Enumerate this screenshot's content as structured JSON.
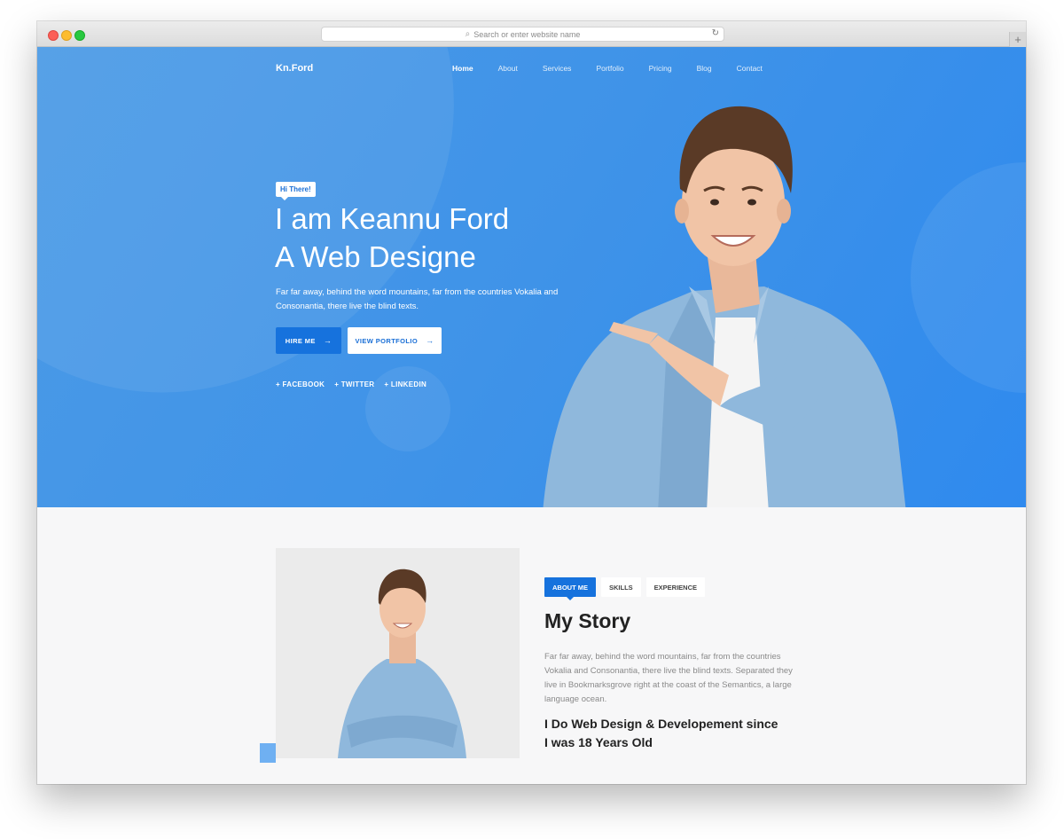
{
  "browser": {
    "address_placeholder": "Search or enter website name",
    "new_tab": "+"
  },
  "header": {
    "logo": "Kn.Ford",
    "nav": [
      "Home",
      "About",
      "Services",
      "Portfolio",
      "Pricing",
      "Blog",
      "Contact"
    ],
    "active_nav": "Home"
  },
  "hero": {
    "badge": "Hi There!",
    "title_line1": "I am Keannu Ford",
    "title_line2": "A Web Designe",
    "text": "Far far away, behind the word mountains, far from the countries Vokalia and Consonantia, there live the blind texts.",
    "hire_label": "HIRE ME",
    "portfolio_label": "VIEW PORTFOLIO",
    "socials": [
      "+ FACEBOOK",
      "+ TWITTER",
      "+ LINKEDIN"
    ]
  },
  "about": {
    "tabs": [
      "ABOUT ME",
      "SKILLS",
      "EXPERIENCE"
    ],
    "active_tab": "ABOUT ME",
    "title": "My Story",
    "text": "Far far away, behind the word mountains, far from the countries Vokalia and Consonantia, there live the blind texts. Separated they live in Bookmarksgrove right at the coast of the Semantics, a large language ocean.",
    "subtitle": "I Do Web Design & Developement since I was 18 Years Old"
  },
  "colors": {
    "hero_blue": "#3f93e8",
    "accent": "#1672dd",
    "shirt": "#8cb6da"
  }
}
